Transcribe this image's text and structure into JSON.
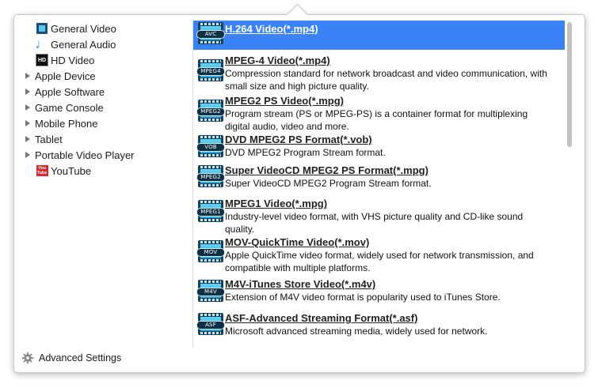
{
  "sidebar": {
    "items": [
      {
        "label": "General Video",
        "icon": "film-icon"
      },
      {
        "label": "General Audio",
        "icon": "music-note-icon"
      },
      {
        "label": "HD Video",
        "icon": "hd-icon",
        "icon_text": "HD"
      },
      {
        "label": "Apple Device"
      },
      {
        "label": "Apple Software"
      },
      {
        "label": "Game Console"
      },
      {
        "label": "Mobile Phone"
      },
      {
        "label": "Tablet"
      },
      {
        "label": "Portable Video Player"
      },
      {
        "label": "YouTube",
        "icon": "youtube-icon",
        "icon_text_1": "You",
        "icon_text_2": "Tube"
      }
    ]
  },
  "formats": [
    {
      "title": "H.264 Video(*.mp4)",
      "badge": "AVC",
      "desc": "",
      "selected": true
    },
    {
      "title": "MPEG-4 Video(*.mp4)",
      "badge": "MPEG4",
      "desc": "Compression standard for network broadcast and video communication, with small size and high picture quality."
    },
    {
      "title": "MPEG2 PS Video(*.mpg)",
      "badge": "MPEG2",
      "desc": "Program stream (PS or MPEG-PS) is a container format for multiplexing digital audio, video and more."
    },
    {
      "title": "DVD MPEG2 PS Format(*.vob)",
      "badge": "VOB",
      "desc": "DVD MPEG2 Program Stream format."
    },
    {
      "title": "Super VideoCD MPEG2 PS Format(*.mpg)",
      "badge": "MPEG2",
      "desc": "Super VideoCD MPEG2 Program Stream format."
    },
    {
      "title": "MPEG1 Video(*.mpg)",
      "badge": "MPEG1",
      "desc": "Industry-level video format, with VHS picture quality and CD-like sound quality."
    },
    {
      "title": "MOV-QuickTime Video(*.mov)",
      "badge": "MOV",
      "desc": "Apple QuickTime video format, widely used for network transmission, and compatible with multiple platforms."
    },
    {
      "title": "M4V-iTunes Store Video(*.m4v)",
      "badge": "M4V",
      "desc": "Extension of M4V video format is popularity used to iTunes Store."
    },
    {
      "title": "ASF-Advanced Streaming Format(*.asf)",
      "badge": "ASF",
      "desc": "Microsoft advanced streaming media, widely used for network."
    }
  ],
  "footer": {
    "label": "Advanced Settings"
  },
  "colors": {
    "selection": "#3b82f6",
    "film": "#14425f",
    "accent": "#56c7ef"
  }
}
